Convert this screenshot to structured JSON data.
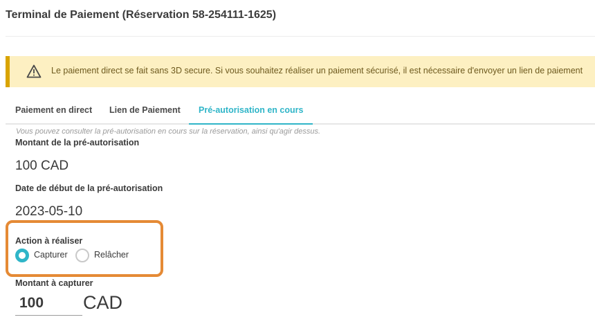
{
  "header": {
    "title": "Terminal de Paiement (Réservation 58-254111-1625)"
  },
  "alert": {
    "icon": "warning-icon",
    "text": "Le paiement direct se fait sans 3D secure. Si vous souhaitez réaliser un paiement sécurisé, il est nécessaire d'envoyer un lien de paiement"
  },
  "tabs": [
    {
      "label": "Paiement en direct",
      "active": false
    },
    {
      "label": "Lien de Paiement",
      "active": false
    },
    {
      "label": "Pré-autorisation en cours",
      "active": true
    }
  ],
  "preauth": {
    "hint": "Vous pouvez consulter la pré-autorisation en cours sur la réservation, ainsi qu'agir dessus.",
    "amount_label": "Montant de la pré-autorisation",
    "amount_value": "100 CAD",
    "date_label": "Date de début de la pré-autorisation",
    "date_value": "2023-05-10",
    "action_label": "Action à réaliser",
    "actions": [
      {
        "label": "Capturer",
        "selected": true
      },
      {
        "label": "Relâcher",
        "selected": false
      }
    ],
    "capture_label": "Montant à capturer",
    "capture_value": "100",
    "capture_currency": "CAD"
  },
  "colors": {
    "accent": "#2fb5c8",
    "alert_background": "#fdf0c2",
    "alert_border": "#d9a400",
    "highlight": "#e58a35"
  }
}
